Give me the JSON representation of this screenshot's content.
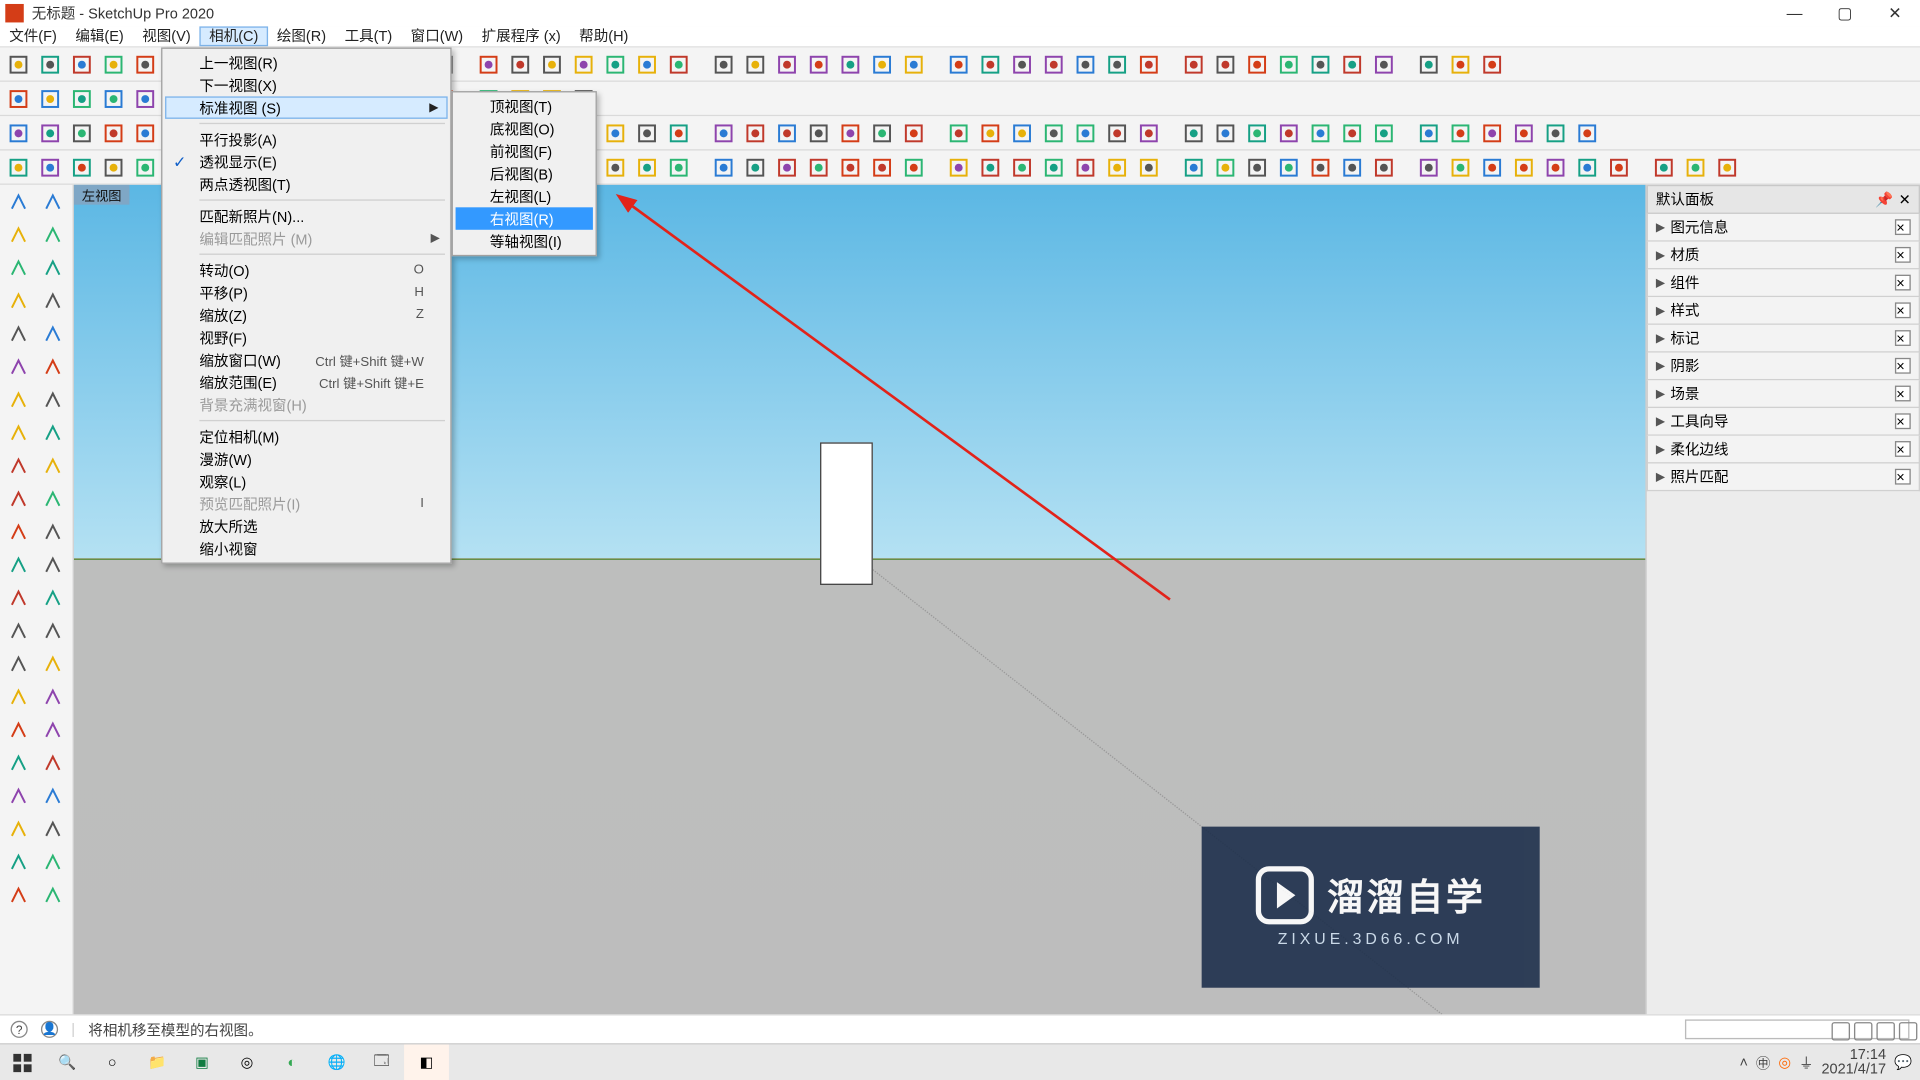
{
  "window": {
    "title": "无标题 - SketchUp Pro 2020"
  },
  "menubar": [
    "文件(F)",
    "编辑(E)",
    "视图(V)",
    "相机(C)",
    "绘图(R)",
    "工具(T)",
    "窗口(W)",
    "扩展程序 (x)",
    "帮助(H)"
  ],
  "menubar_open_index": 3,
  "camera_menu": {
    "groups": [
      [
        {
          "label": "上一视图(R)"
        },
        {
          "label": "下一视图(X)"
        },
        {
          "label": "标准视图 (S)",
          "submenu": true,
          "highlight": true
        }
      ],
      [
        {
          "label": "平行投影(A)"
        },
        {
          "label": "透视显示(E)",
          "checked": true
        },
        {
          "label": "两点透视图(T)"
        }
      ],
      [
        {
          "label": "匹配新照片(N)..."
        },
        {
          "label": "编辑匹配照片 (M)",
          "disabled": true,
          "submenu": true
        }
      ],
      [
        {
          "label": "转动(O)",
          "shortcut": "O"
        },
        {
          "label": "平移(P)",
          "shortcut": "H"
        },
        {
          "label": "缩放(Z)",
          "shortcut": "Z"
        },
        {
          "label": "视野(F)"
        },
        {
          "label": "缩放窗口(W)",
          "shortcut": "Ctrl 键+Shift 键+W"
        },
        {
          "label": "缩放范围(E)",
          "shortcut": "Ctrl 键+Shift 键+E"
        },
        {
          "label": "背景充满视窗(H)",
          "disabled": true
        }
      ],
      [
        {
          "label": "定位相机(M)"
        },
        {
          "label": "漫游(W)"
        },
        {
          "label": "观察(L)"
        },
        {
          "label": "预览匹配照片(I)",
          "disabled": true,
          "shortcut": "I"
        },
        {
          "label": "放大所选"
        },
        {
          "label": "缩小视窗"
        }
      ]
    ]
  },
  "standard_views": [
    {
      "label": "顶视图(T)"
    },
    {
      "label": "底视图(O)"
    },
    {
      "label": "前视图(F)"
    },
    {
      "label": "后视图(B)"
    },
    {
      "label": "左视图(L)"
    },
    {
      "label": "右视图(R)",
      "selected": true
    },
    {
      "label": "等轴视图(I)"
    }
  ],
  "tray": {
    "title": "默认面板",
    "panels": [
      "图元信息",
      "材质",
      "组件",
      "样式",
      "标记",
      "阴影",
      "场景",
      "工具向导",
      "柔化边线",
      "照片匹配"
    ]
  },
  "viewport_label": "左视图",
  "status": {
    "text": "将相机移至模型的右视图。"
  },
  "watermark": {
    "brand": "溜溜自学",
    "url": "ZIXUE.3D66.COM"
  },
  "taskbar": {
    "time": "17:14",
    "date": "2021/4/17"
  },
  "colors": {
    "menu_highlight": "#d6ebff",
    "menu_selected": "#3399ff",
    "sky_top": "#5bb7e4",
    "ground": "#bdbdbd",
    "arrow": "#e2231a"
  },
  "toolbar_rows": 4,
  "left_tool_rows": 22
}
